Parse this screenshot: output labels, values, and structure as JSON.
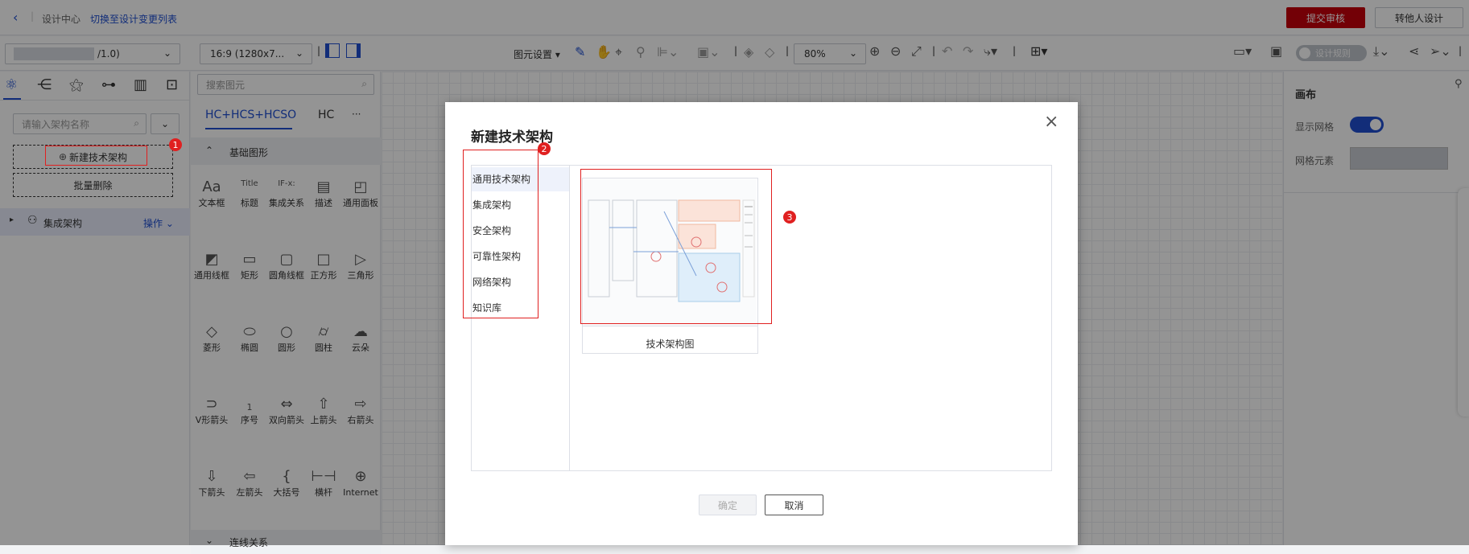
{
  "header": {
    "breadcrumb_root": "设计中心",
    "switch_link": "切换至设计变更列表",
    "submit_button": "提交审核",
    "transfer_button": "转他人设计"
  },
  "toolbar": {
    "version_select": "/1.0)",
    "ratio_select": "16:9 (1280x7...",
    "shape_settings": "图元设置",
    "zoom": "80%",
    "design_rules": "设计规则"
  },
  "left_panel": {
    "search_placeholder": "请输入架构名称",
    "new_button": "新建技术架构",
    "batch_delete": "批量删除",
    "tree_item": "集成架构",
    "tree_action": "操作"
  },
  "shape_panel": {
    "search_placeholder": "搜索图元",
    "tab_active": "HC+HCS+HCSO",
    "tab_other": "HC",
    "tab_more": "···",
    "section_title": "基础图形",
    "section_bottom": "连线关系",
    "shapes": [
      {
        "icon": "Aa",
        "label": "文本框"
      },
      {
        "icon": "Title",
        "label": "标题"
      },
      {
        "icon": "IF-x:",
        "label": "集成关系"
      },
      {
        "icon": "▤",
        "label": "描述"
      },
      {
        "icon": "◰",
        "label": "通用面板"
      },
      {
        "icon": "◩",
        "label": "通用线框"
      },
      {
        "icon": "▭",
        "label": "矩形"
      },
      {
        "icon": "▢",
        "label": "圆角线框"
      },
      {
        "icon": "□",
        "label": "正方形"
      },
      {
        "icon": "▷",
        "label": "三角形"
      },
      {
        "icon": "◇",
        "label": "菱形"
      },
      {
        "icon": "⬭",
        "label": "椭圆"
      },
      {
        "icon": "○",
        "label": "圆形"
      },
      {
        "icon": "⌭",
        "label": "圆柱"
      },
      {
        "icon": "☁",
        "label": "云朵"
      },
      {
        "icon": "⊃",
        "label": "V形箭头"
      },
      {
        "icon": "1",
        "label": "序号"
      },
      {
        "icon": "⇔",
        "label": "双向箭头"
      },
      {
        "icon": "⇧",
        "label": "上箭头"
      },
      {
        "icon": "⇨",
        "label": "右箭头"
      },
      {
        "icon": "⇩",
        "label": "下箭头"
      },
      {
        "icon": "⇦",
        "label": "左箭头"
      },
      {
        "icon": "{",
        "label": "大括号"
      },
      {
        "icon": "⊢⊣",
        "label": "横杆"
      },
      {
        "icon": "⊕",
        "label": "Internet"
      }
    ]
  },
  "right_panel": {
    "title": "画布",
    "show_grid": "显示网格",
    "grid_element": "网格元素"
  },
  "modal": {
    "title": "新建技术架构",
    "categories": [
      "通用技术架构",
      "集成架构",
      "安全架构",
      "可靠性架构",
      "网络架构",
      "知识库"
    ],
    "template_name": "技术架构图",
    "confirm": "确定",
    "cancel": "取消"
  },
  "annotations": [
    "1",
    "2",
    "3"
  ],
  "colors": {
    "primary": "#1f4fd1",
    "danger": "#c7000b",
    "annotation": "#e02020"
  }
}
